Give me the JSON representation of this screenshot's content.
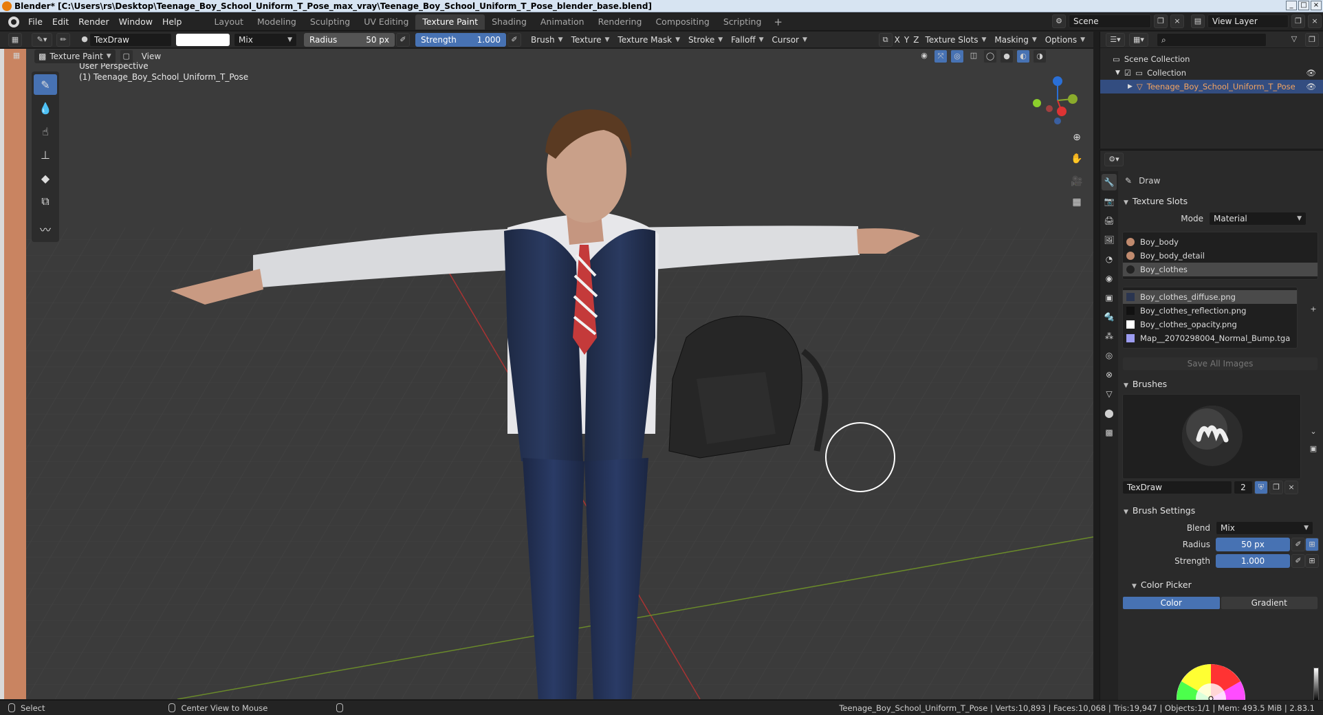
{
  "window": {
    "title": "Blender* [C:\\Users\\rs\\Desktop\\Teenage_Boy_School_Uniform_T_Pose_max_vray\\Teenage_Boy_School_Uniform_T_Pose_blender_base.blend]"
  },
  "menu": {
    "file": "File",
    "edit": "Edit",
    "render": "Render",
    "window": "Window",
    "help": "Help"
  },
  "workspaces": [
    "Layout",
    "Modeling",
    "Sculpting",
    "UV Editing",
    "Texture Paint",
    "Shading",
    "Animation",
    "Rendering",
    "Compositing",
    "Scripting"
  ],
  "active_workspace": "Texture Paint",
  "scene": {
    "scene_label": "Scene",
    "view_layer": "View Layer"
  },
  "tool_header": {
    "brush_name": "TexDraw",
    "blend": "Mix",
    "radius_label": "Radius",
    "radius_value": "50 px",
    "strength_label": "Strength",
    "strength_value": "1.000",
    "brush": "Brush",
    "texture": "Texture",
    "texture_mask": "Texture Mask",
    "stroke": "Stroke",
    "falloff": "Falloff",
    "cursor": "Cursor",
    "axes": [
      "X",
      "Y",
      "Z"
    ],
    "texture_slots": "Texture Slots",
    "masking": "Masking",
    "options": "Options"
  },
  "viewport_header": {
    "mode": "Texture Paint",
    "view": "View"
  },
  "viewport": {
    "perspective": "User Perspective",
    "object_label": "(1) Teenage_Boy_School_Uniform_T_Pose"
  },
  "outliner": {
    "scene_collection": "Scene Collection",
    "collection": "Collection",
    "object": "Teenage_Boy_School_Uniform_T_Pose"
  },
  "properties": {
    "tool_name": "Draw",
    "texture_slots": {
      "title": "Texture Slots",
      "mode_label": "Mode",
      "mode_value": "Material",
      "materials": [
        {
          "name": "Boy_body",
          "color": "#c08a6e"
        },
        {
          "name": "Boy_body_detail",
          "color": "#c08a6e"
        },
        {
          "name": "Boy_clothes",
          "color": "#222222"
        }
      ],
      "selected_material": "Boy_clothes",
      "images": [
        {
          "name": "Boy_clothes_diffuse.png",
          "color": "#2a3550"
        },
        {
          "name": "Boy_clothes_reflection.png",
          "color": "#111111"
        },
        {
          "name": "Boy_clothes_opacity.png",
          "color": "#ffffff"
        },
        {
          "name": "Map__2070298004_Normal_Bump.tga",
          "color": "#9c9cf0"
        }
      ],
      "selected_image": "Boy_clothes_diffuse.png",
      "save_all": "Save All Images"
    },
    "brushes": {
      "title": "Brushes",
      "brush_name": "TexDraw",
      "users": "2"
    },
    "brush_settings": {
      "title": "Brush Settings",
      "blend_label": "Blend",
      "blend_value": "Mix",
      "radius_label": "Radius",
      "radius_value": "50 px",
      "strength_label": "Strength",
      "strength_value": "1.000"
    },
    "color_picker": {
      "title": "Color Picker",
      "tab_color": "Color",
      "tab_gradient": "Gradient"
    }
  },
  "statusbar": {
    "select": "Select",
    "center": "Center View to Mouse",
    "stats": "Teenage_Boy_School_Uniform_T_Pose | Verts:10,893 | Faces:10,068 | Tris:19,947 | Objects:1/1 | Mem: 493.5 MiB | 2.83.1"
  },
  "colors": {
    "accent": "#4772b3",
    "active_object": "#f4a460",
    "brush_color": "#ffffff"
  }
}
